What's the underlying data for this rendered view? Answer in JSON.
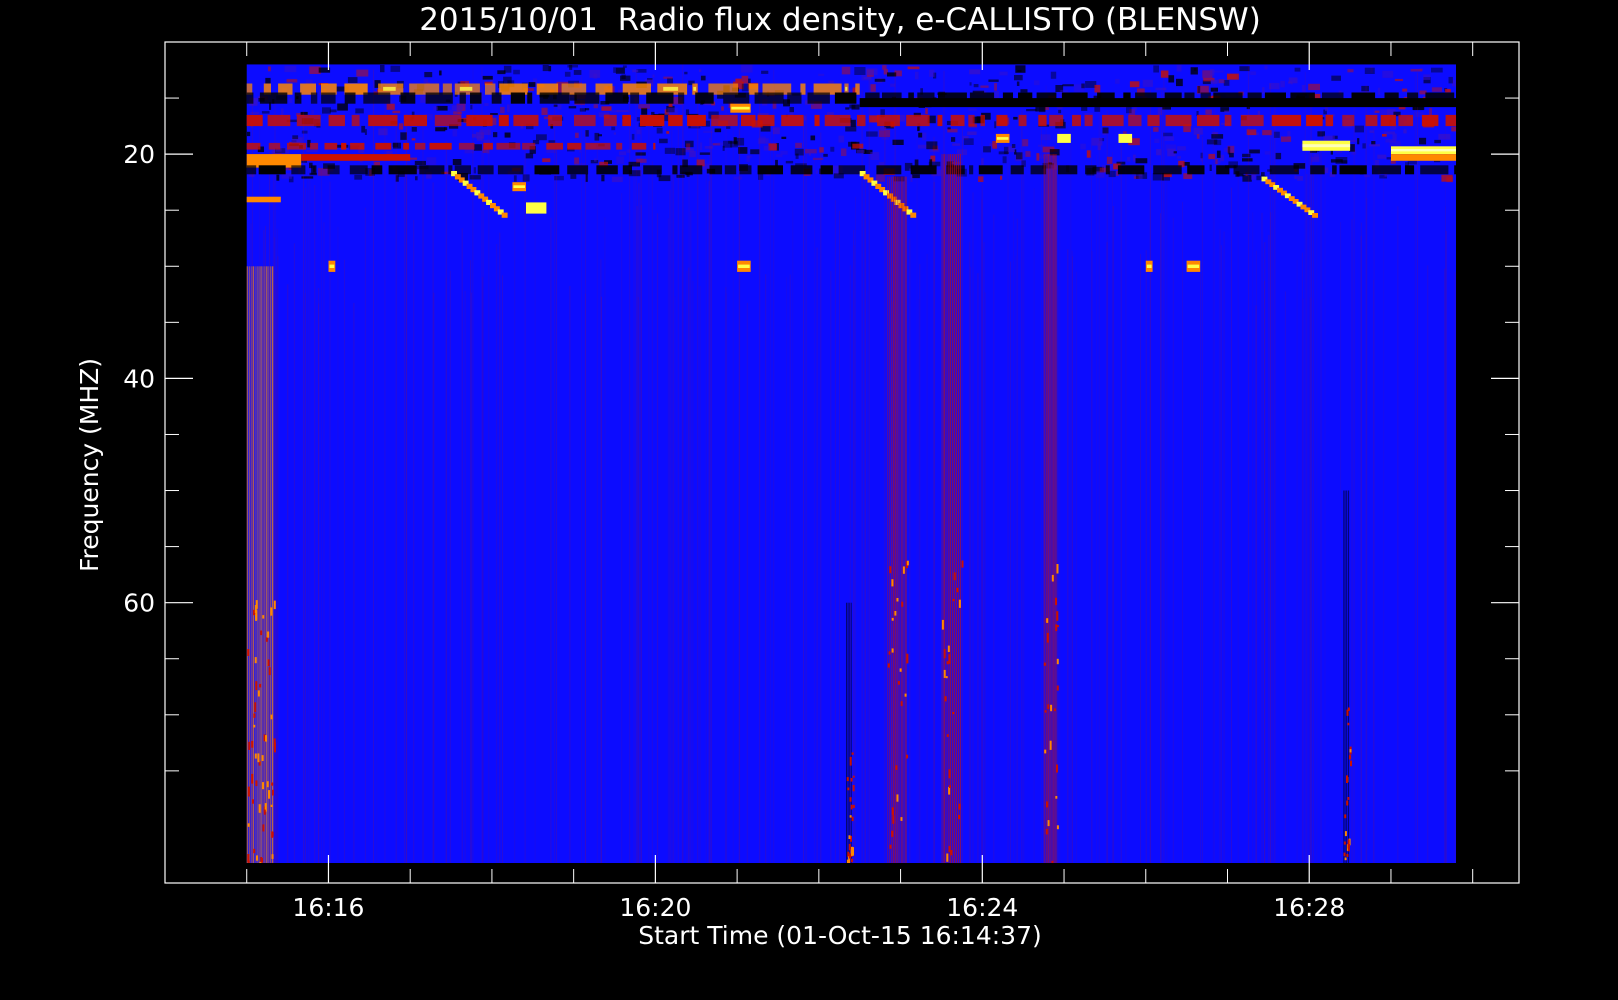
{
  "chart_data": {
    "type": "heatmap",
    "title": "2015/10/01  Radio flux density, e-CALLISTO (BLENSW)",
    "xlabel": "Start Time (01-Oct-15 16:14:37)",
    "ylabel": "Frequency (MHZ)",
    "x_unit": "minutes of 01-Oct-15",
    "xlim": [
      "16:14:00",
      "16:30:34"
    ],
    "data_xlim": [
      "16:15:00",
      "16:30:00"
    ],
    "ylim": [
      10,
      85
    ],
    "data_ylim": [
      12,
      84
    ],
    "y_direction": "increasing-downward",
    "x_ticks": [
      {
        "value": "16:16",
        "label": "16:16"
      },
      {
        "value": "16:20",
        "label": "16:20"
      },
      {
        "value": "16:24",
        "label": "16:24"
      },
      {
        "value": "16:28",
        "label": "16:28"
      }
    ],
    "y_ticks": [
      {
        "value": 20,
        "label": "20"
      },
      {
        "value": 40,
        "label": "40"
      },
      {
        "value": 60,
        "label": "60"
      }
    ],
    "colormap": {
      "background": "#0c0cff",
      "low": "#000000",
      "mid": "#cc1100",
      "high": "#ff8800",
      "peak": "#ffff44"
    },
    "features": [
      {
        "kind": "band",
        "t0": "16:15:00",
        "t1": "16:22:30",
        "f0": 13.7,
        "f1": 14.7,
        "intensity": "high",
        "pattern": "dashed"
      },
      {
        "kind": "band",
        "t0": "16:15:00",
        "t1": "16:29:55",
        "f0": 16.5,
        "f1": 17.5,
        "intensity": "mid",
        "pattern": "dashed"
      },
      {
        "kind": "band",
        "t0": "16:15:00",
        "t1": "16:20:00",
        "f0": 19.0,
        "f1": 19.6,
        "intensity": "mid",
        "pattern": "dashed"
      },
      {
        "kind": "band",
        "t0": "16:15:00",
        "t1": "16:15:40",
        "f0": 20.0,
        "f1": 21.2,
        "intensity": "high",
        "pattern": "solid"
      },
      {
        "kind": "band",
        "t0": "16:15:40",
        "t1": "16:17:00",
        "f0": 20.0,
        "f1": 20.6,
        "intensity": "mid",
        "pattern": "solid"
      },
      {
        "kind": "band",
        "t0": "16:27:55",
        "t1": "16:28:30",
        "f0": 18.8,
        "f1": 19.7,
        "intensity": "peak",
        "pattern": "solid"
      },
      {
        "kind": "band",
        "t0": "16:29:00",
        "t1": "16:30:00",
        "f0": 19.3,
        "f1": 20.0,
        "intensity": "peak",
        "pattern": "solid"
      },
      {
        "kind": "band",
        "t0": "16:29:00",
        "t1": "16:30:00",
        "f0": 20.0,
        "f1": 20.6,
        "intensity": "high",
        "pattern": "solid"
      },
      {
        "kind": "band",
        "t0": "16:15:00",
        "t1": "16:15:25",
        "f0": 23.8,
        "f1": 24.3,
        "intensity": "high",
        "pattern": "solid"
      },
      {
        "kind": "band",
        "t0": "16:15:00",
        "t1": "16:30:00",
        "f0": 14.5,
        "f1": 15.5,
        "intensity": "low",
        "pattern": "dashed"
      },
      {
        "kind": "band",
        "t0": "16:15:00",
        "t1": "16:30:00",
        "f0": 21.0,
        "f1": 21.8,
        "intensity": "low",
        "pattern": "dashed"
      },
      {
        "kind": "drift",
        "t0": "16:17:30",
        "t1": "16:18:10",
        "f0": 21.5,
        "f1": 25.5,
        "intensity": "high"
      },
      {
        "kind": "drift",
        "t0": "16:22:30",
        "t1": "16:23:10",
        "f0": 21.5,
        "f1": 25.5,
        "intensity": "high"
      },
      {
        "kind": "drift",
        "t0": "16:27:25",
        "t1": "16:28:05",
        "f0": 22.0,
        "f1": 25.5,
        "intensity": "high"
      },
      {
        "kind": "spot",
        "t0": "16:18:25",
        "t1": "16:18:40",
        "f0": 24.3,
        "f1": 25.3,
        "intensity": "peak"
      },
      {
        "kind": "spot",
        "t0": "16:18:15",
        "t1": "16:18:25",
        "f0": 22.5,
        "f1": 23.3,
        "intensity": "high"
      },
      {
        "kind": "spot",
        "t0": "16:16:00",
        "t1": "16:16:05",
        "f0": 29.5,
        "f1": 30.5,
        "intensity": "high"
      },
      {
        "kind": "spot",
        "t0": "16:21:00",
        "t1": "16:21:10",
        "f0": 29.5,
        "f1": 30.5,
        "intensity": "high"
      },
      {
        "kind": "spot",
        "t0": "16:26:00",
        "t1": "16:26:05",
        "f0": 29.5,
        "f1": 30.5,
        "intensity": "high"
      },
      {
        "kind": "spot",
        "t0": "16:26:30",
        "t1": "16:26:40",
        "f0": 29.5,
        "f1": 30.5,
        "intensity": "high"
      },
      {
        "kind": "spot",
        "t0": "16:25:40",
        "t1": "16:25:50",
        "f0": 18.2,
        "f1": 19.0,
        "intensity": "peak"
      },
      {
        "kind": "spot",
        "t0": "16:24:55",
        "t1": "16:25:05",
        "f0": 18.2,
        "f1": 19.0,
        "intensity": "peak"
      },
      {
        "kind": "spot",
        "t0": "16:24:10",
        "t1": "16:24:20",
        "f0": 18.2,
        "f1": 19.0,
        "intensity": "high"
      },
      {
        "kind": "spot",
        "t0": "16:20:55",
        "t1": "16:21:10",
        "f0": 15.5,
        "f1": 16.3,
        "intensity": "high"
      },
      {
        "kind": "vertical",
        "t0": "16:15:00",
        "t1": "16:15:20",
        "f0": 30,
        "f1": 84,
        "intensity": "high"
      },
      {
        "kind": "vertical",
        "t0": "16:22:50",
        "t1": "16:23:05",
        "f0": 22,
        "f1": 84,
        "intensity": "mid"
      },
      {
        "kind": "vertical",
        "t0": "16:23:30",
        "t1": "16:23:45",
        "f0": 20,
        "f1": 84,
        "intensity": "mid"
      },
      {
        "kind": "vertical",
        "t0": "16:24:45",
        "t1": "16:24:55",
        "f0": 20,
        "f1": 84,
        "intensity": "mid"
      },
      {
        "kind": "vertical",
        "t0": "16:22:20",
        "t1": "16:22:25",
        "f0": 60,
        "f1": 84,
        "intensity": "low"
      },
      {
        "kind": "vertical",
        "t0": "16:28:25",
        "t1": "16:28:30",
        "f0": 50,
        "f1": 84,
        "intensity": "low"
      },
      {
        "kind": "dark-band",
        "t0": "16:22:30",
        "t1": "16:30:00",
        "f0": 15.0,
        "f1": 15.8,
        "intensity": "low"
      }
    ]
  }
}
